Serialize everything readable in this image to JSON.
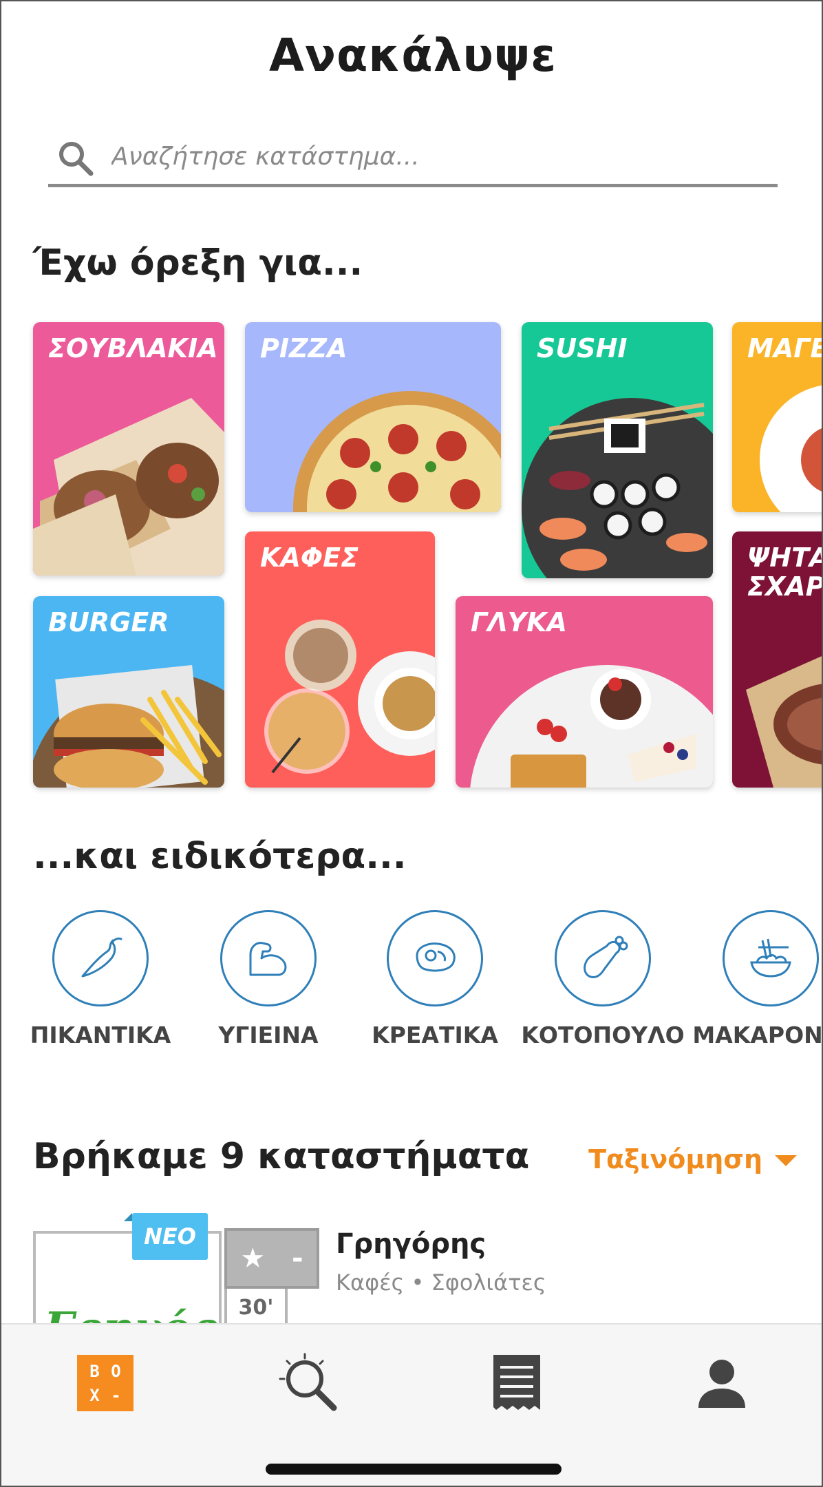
{
  "header": {
    "title": "Ανακάλυψε"
  },
  "search": {
    "placeholder": "Αναζήτησε κατάστημα..."
  },
  "categories_section": {
    "title": "Έχω όρεξη για..."
  },
  "categories": [
    {
      "label": "ΣΟΥΒΛΑΚΙΑ",
      "color": "#ec5a9a"
    },
    {
      "label": "PIZZA",
      "color": "#a7b7fb"
    },
    {
      "label": "SUSHI",
      "color": "#16c896"
    },
    {
      "label": "ΜΑΓΕΙ",
      "color": "#fbb428"
    },
    {
      "label": "BURGER",
      "color": "#4bb6f2"
    },
    {
      "label": "ΚΑΦΕΣ",
      "color": "#ff5f5a"
    },
    {
      "label": "ΓΛΥΚΑ",
      "color": "#ec5a8e"
    },
    {
      "label": "ΨΗΤΑ\nΣΧΑΡΑ",
      "color": "#7d1236"
    }
  ],
  "specialties_section": {
    "title": "...και ειδικότερα..."
  },
  "specialties": [
    {
      "label": "ΠΙΚΑΝΤΙΚΑ",
      "icon": "chili-pepper-icon"
    },
    {
      "label": "ΥΓΙΕΙΝΑ",
      "icon": "bicep-icon"
    },
    {
      "label": "ΚΡΕΑΤΙΚΑ",
      "icon": "steak-icon"
    },
    {
      "label": "ΚΟΤΟΠΟΥΛΟ",
      "icon": "chicken-leg-icon"
    },
    {
      "label": "ΜΑΚΑΡΟΝΙΑ",
      "icon": "pasta-bowl-icon"
    }
  ],
  "results": {
    "title": "Βρήκαμε 9 καταστήματα",
    "sort_label": "Ταξινόμηση",
    "accent_color": "#f08c1e"
  },
  "stores": [
    {
      "name": "Γρηγόρης",
      "tags": "Καφές • Σφολιάτες",
      "badge": "ΝΕΟ",
      "rating": "-",
      "eta": "30'",
      "logo_text": "Γρηγόρης"
    }
  ],
  "tabbar": {
    "box_logo": [
      "B",
      "O",
      "X",
      "-"
    ],
    "items": [
      "home-box-logo",
      "search-icon",
      "orders-receipt-icon",
      "profile-icon"
    ],
    "brand_color": "#f68b1f"
  }
}
